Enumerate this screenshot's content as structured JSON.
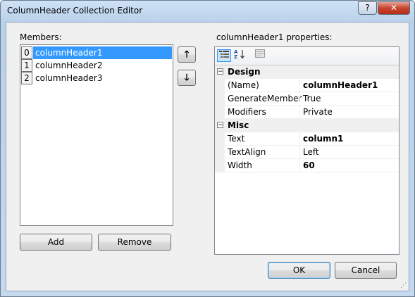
{
  "window": {
    "title": "ColumnHeader Collection Editor",
    "help_label": "?",
    "close_label": "✕"
  },
  "members": {
    "label": "Members:",
    "items": [
      {
        "index": "0",
        "name": "columnHeader1"
      },
      {
        "index": "1",
        "name": "columnHeader2"
      },
      {
        "index": "2",
        "name": "columnHeader3"
      }
    ],
    "selected_index": 0,
    "move_up_label": "🡑",
    "move_down_label": "🡓",
    "add_label": "Add",
    "remove_label": "Remove"
  },
  "properties": {
    "label": "columnHeader1 properties:",
    "toolbar_icons": [
      "categorized-icon",
      "alphabetical-icon",
      "property-pages-icon"
    ],
    "categories": [
      {
        "name": "Design",
        "rows": [
          {
            "name": "(Name)",
            "value": "columnHeader1",
            "bold": true
          },
          {
            "name": "GenerateMember",
            "value": "True",
            "bold": false
          },
          {
            "name": "Modifiers",
            "value": "Private",
            "bold": false
          }
        ]
      },
      {
        "name": "Misc",
        "rows": [
          {
            "name": "Text",
            "value": "column1",
            "bold": true
          },
          {
            "name": "TextAlign",
            "value": "Left",
            "bold": false
          },
          {
            "name": "Width",
            "value": "60",
            "bold": true
          }
        ]
      }
    ],
    "expand_glyph": "−"
  },
  "buttons": {
    "ok_label": "OK",
    "cancel_label": "Cancel"
  }
}
